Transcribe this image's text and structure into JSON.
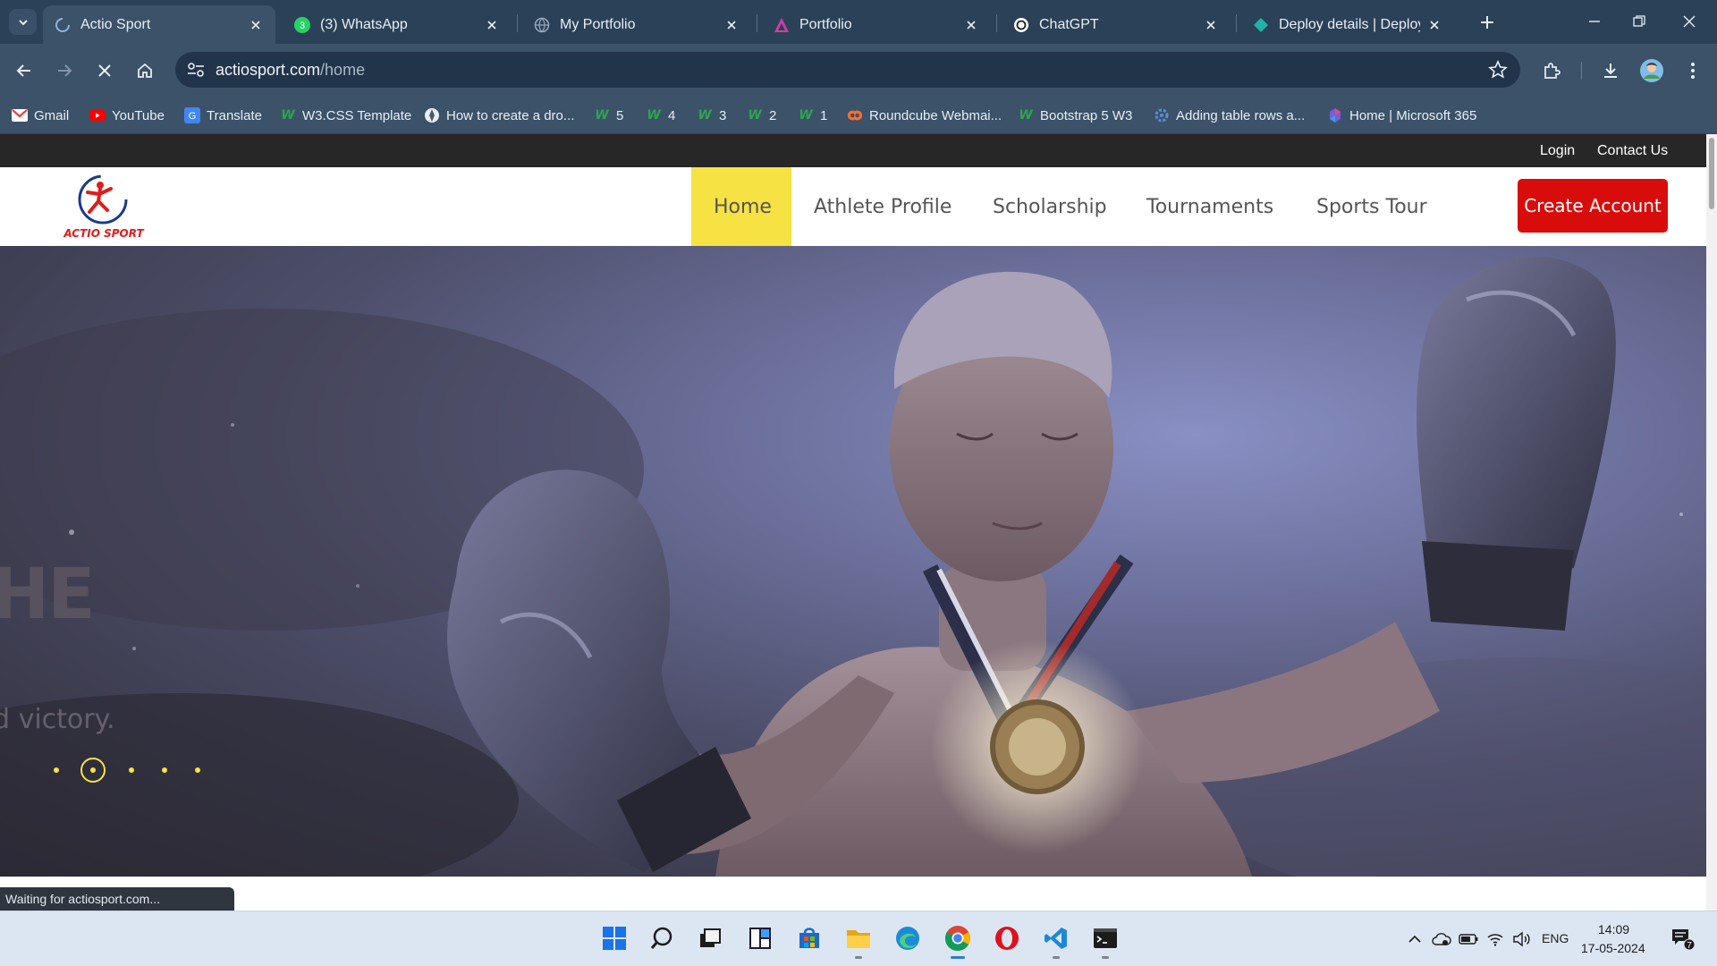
{
  "browser": {
    "tabs": [
      {
        "title": "Actio Sport",
        "active": true
      },
      {
        "title": "(3) WhatsApp",
        "active": false
      },
      {
        "title": "My Portfolio",
        "active": false
      },
      {
        "title": "Portfolio",
        "active": false
      },
      {
        "title": "ChatGPT",
        "active": false
      },
      {
        "title": "Deploy details | Deploys | r",
        "active": false
      }
    ],
    "whatsapp_badge": "3",
    "url_host": "actiosport.com",
    "url_path": "/home",
    "bookmarks": [
      {
        "label": "Gmail",
        "icon": "gmail-icon"
      },
      {
        "label": "YouTube",
        "icon": "youtube-icon"
      },
      {
        "label": "Translate",
        "icon": "translate-icon"
      },
      {
        "label": "W3.CSS Template",
        "icon": "w3schools-icon"
      },
      {
        "label": "How to create a dro...",
        "icon": "globe-icon"
      },
      {
        "label": "5",
        "icon": "w3schools-icon"
      },
      {
        "label": "4",
        "icon": "w3schools-icon"
      },
      {
        "label": "3",
        "icon": "w3schools-icon"
      },
      {
        "label": "2",
        "icon": "w3schools-icon"
      },
      {
        "label": "1",
        "icon": "w3schools-icon"
      },
      {
        "label": "Roundcube Webmai...",
        "icon": "cpanel-icon"
      },
      {
        "label": "Bootstrap 5 W3",
        "icon": "w3schools-icon"
      },
      {
        "label": "Adding table rows a...",
        "icon": "gear-icon"
      },
      {
        "label": "Home | Microsoft 365",
        "icon": "microsoft-365-icon"
      }
    ],
    "status_text": "Waiting for actiosport.com..."
  },
  "site": {
    "topbar": {
      "login": "Login",
      "contact": "Contact Us"
    },
    "logo_text": "ACTIO SPORT",
    "nav": [
      {
        "label": "Home",
        "active": true
      },
      {
        "label": "Athlete Profile",
        "active": false
      },
      {
        "label": "Scholarship",
        "active": false
      },
      {
        "label": "Tournaments",
        "active": false
      },
      {
        "label": "Sports Tour",
        "active": false
      }
    ],
    "cta": "Create Account",
    "hero": {
      "heading_fragment": "HE",
      "sub_fragment": "d victory.",
      "slides": 5,
      "active_slide": 2
    },
    "colors": {
      "accent_yellow": "#f7e244",
      "cta_red": "#d90c0c",
      "topbar": "#272727"
    }
  },
  "taskbar": {
    "apps": [
      {
        "name": "start-icon"
      },
      {
        "name": "search-icon"
      },
      {
        "name": "task-view-icon"
      },
      {
        "name": "widgets-icon"
      },
      {
        "name": "microsoft-store-icon"
      },
      {
        "name": "file-explorer-icon"
      },
      {
        "name": "edge-icon"
      },
      {
        "name": "chrome-icon"
      },
      {
        "name": "opera-icon"
      },
      {
        "name": "vscode-icon"
      },
      {
        "name": "terminal-icon"
      }
    ],
    "language": "ENG",
    "time": "14:09",
    "date": "17-05-2024",
    "notification_count": "7"
  }
}
